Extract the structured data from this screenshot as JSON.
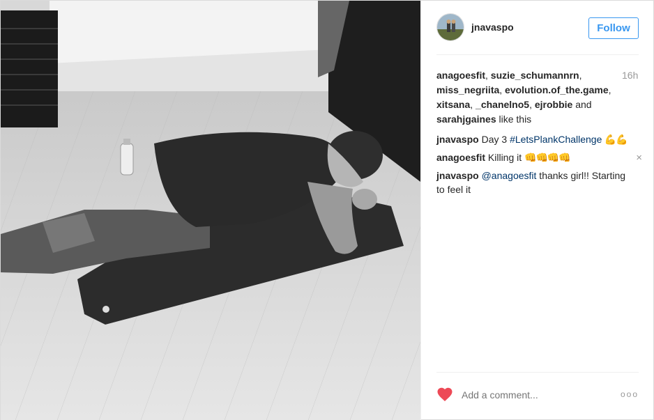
{
  "post": {
    "username": "jnavaspo",
    "follow_label": "Follow",
    "time": "16h",
    "likes": {
      "users": [
        "anagoesfit",
        "suzie_schumannrn",
        "miss_negriita",
        "evolution.of_the.game",
        "xitsana",
        "_chanelno5",
        "ejrobbie",
        "sarahjgaines"
      ],
      "separator": ", ",
      "and_label": " and ",
      "suffix": " like this"
    },
    "comments": [
      {
        "author": "jnavaspo",
        "text": " Day 3 ",
        "tag": "#LetsPlankChallenge",
        "emoji": " 💪💪"
      },
      {
        "author": "anagoesfit",
        "text": " Killing it ",
        "emoji": "👊👊👊👊",
        "removable": true,
        "remove_icon": "×"
      },
      {
        "author": "jnavaspo",
        "mention": " @anagoesfit",
        "text": " thanks girl!! Starting to feel it"
      }
    ],
    "add_comment_placeholder": "Add a comment...",
    "more_label": "ooo",
    "icons": [
      "heart-icon",
      "more-options-icon",
      "close-icon"
    ],
    "colors": {
      "accent": "#3897f0",
      "heart": "#ed4956",
      "hashtag": "#003569",
      "muted": "#999999"
    }
  }
}
